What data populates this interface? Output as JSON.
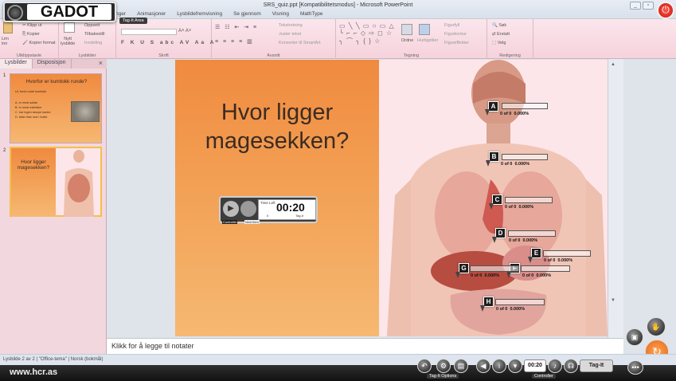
{
  "window": {
    "title": "SRS_quiz.ppt [Kompatibilitetsmodus] - Microsoft PowerPoint",
    "menu": [
      "Lysbildefremvisning",
      "Se gjennom",
      "Visning",
      "MathType"
    ],
    "menu_partial": [
      "ninger",
      "Animasjoner"
    ],
    "minimize": "_",
    "restore": "▫"
  },
  "gadot": {
    "label": "GADOT",
    "tag_area": "Tag-It Area"
  },
  "ribbon": {
    "groups": [
      "Utklippstavle",
      "Lysbilder",
      "Skrift",
      "Avsnitt",
      "Tegning",
      "Redigering"
    ],
    "clipboard": {
      "paste": "Lim\ninn",
      "cut": "Klipp ut",
      "copy": "Kopier",
      "format": "Kopier format"
    },
    "slides": {
      "new": "Nytt\nlysbilde",
      "layout": "Oppsett",
      "reset": "Tilbakestill",
      "section": "Inndeling"
    },
    "paragraph": {
      "direction": "Tekstretning",
      "align": "Juster tekst",
      "smartart": "Konverter til SmartArt"
    },
    "drawing": {
      "arrange": "Ordne",
      "quickstyles": "Hurtigstiler",
      "fill": "Figurfyll",
      "outline": "Figurkontur",
      "effects": "Figureffekter"
    },
    "editing": {
      "find": "Søk",
      "replace": "Erstatt",
      "select": "Velg"
    }
  },
  "pane": {
    "tabs": [
      "Lysbilder",
      "Disposisjon"
    ],
    "close": "×",
    "slides": [
      {
        "number": "1",
        "title": "Hvorfor er kumlokk runde?",
        "subtitle": "Ut, fordi runde kumlokk",
        "options": [
          "A.  er mest solide",
          "B.  er mest estetiske",
          "C.  har ingen skarpe kanter",
          "D.  faller ikke ned i hullet"
        ]
      },
      {
        "number": "2",
        "title": "Hvor ligger magesekken?"
      }
    ]
  },
  "slide": {
    "question_line1": "Hvor ligger",
    "question_line2": "magesekken?",
    "timer": {
      "label": "Time Left",
      "value": "00:20",
      "scale_min": "0",
      "scale_max": "Tag-It",
      "controller": "Controller",
      "next": "Next item"
    },
    "markers": [
      {
        "label": "A",
        "count": "0 of 0",
        "pct": "0.000%"
      },
      {
        "label": "B",
        "count": "0 of 0",
        "pct": "0.000%"
      },
      {
        "label": "C",
        "count": "0 of 0",
        "pct": "0.000%"
      },
      {
        "label": "D",
        "count": "0 of 0",
        "pct": "0.000%"
      },
      {
        "label": "E",
        "count": "0 of 0",
        "pct": "0.000%"
      },
      {
        "label": "F",
        "count": "0 of 0",
        "pct": "0.000%"
      },
      {
        "label": "G",
        "count": "0 of 0",
        "pct": "0.000%"
      },
      {
        "label": "H",
        "count": "0 of 0",
        "pct": "0.000%"
      }
    ]
  },
  "notes": {
    "placeholder": "Klikk for å legge til notater"
  },
  "status": {
    "slide": "Lysbilde 2 av 2",
    "theme": "\"Office-tema\"",
    "language": "Norsk (bokmål)"
  },
  "bottom": {
    "site": "www.hcr.as",
    "tag_options": "Tag-It Options",
    "controller": "Controller",
    "timer": "00:20",
    "tagit": "Tag-It"
  }
}
